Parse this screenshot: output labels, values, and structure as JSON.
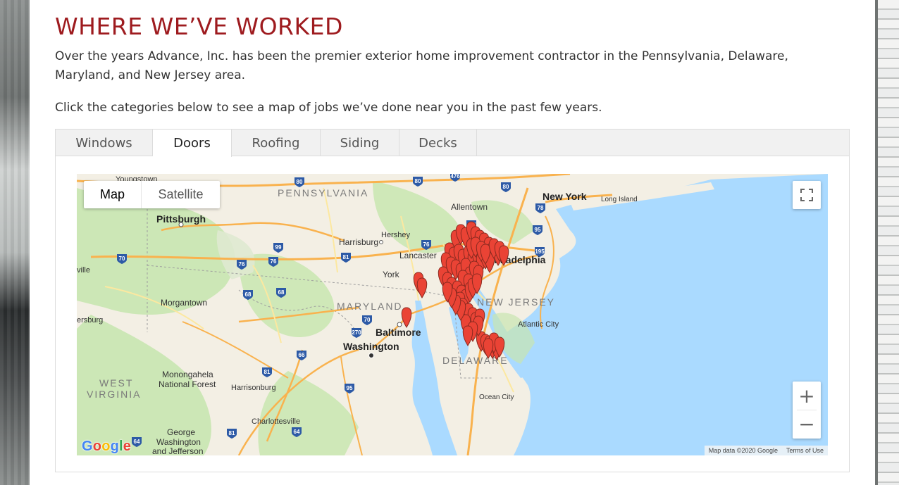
{
  "page": {
    "heading": "WHERE WE’VE WORKED",
    "intro": "Over the years Advance, Inc. has been the premier exterior home improvement contractor in the Pennsylvania, Delaware, Maryland, and New Jersey area.",
    "cta": "Click the categories below to see a map of jobs we’ve done near you in the past few years."
  },
  "tabs": [
    {
      "label": "Windows",
      "active": false
    },
    {
      "label": "Doors",
      "active": true
    },
    {
      "label": "Roofing",
      "active": false
    },
    {
      "label": "Siding",
      "active": false
    },
    {
      "label": "Decks",
      "active": false
    }
  ],
  "map": {
    "type_control": {
      "map_label": "Map",
      "satellite_label": "Satellite",
      "selected": "Map"
    },
    "zoom_in": "+",
    "zoom_out": "−",
    "attribution": "Map data ©2020 Google",
    "terms": "Terms of Use",
    "logo": {
      "G": "G",
      "o1": "o",
      "o2": "o",
      "g": "g",
      "l": "l",
      "e": "e"
    },
    "state_labels": [
      "PENNSYLVANIA",
      "MARYLAND",
      "NEW JERSEY",
      "DELAWARE",
      "WEST",
      "VIRGINIA"
    ],
    "city_labels": [
      "Youngstown",
      "Pittsburgh",
      "Allentown",
      "New York",
      "Long Island",
      "Harrisburg",
      "Hershey",
      "Lancaster",
      "York",
      "Philadelphia",
      "Morgantown",
      "Atlantic City",
      "Baltimore",
      "Washington",
      "Ocean City",
      "Monongahela",
      "National Forest",
      "Harrisonburg",
      "Charlottesville",
      "George",
      "Washington",
      "and Jefferson",
      "ville",
      "ersburg"
    ],
    "highway_labels": [
      "80",
      "80",
      "476",
      "80",
      "78",
      "476",
      "95",
      "76",
      "99",
      "76",
      "81",
      "70",
      "76",
      "195",
      "68",
      "68",
      "70",
      "270",
      "66",
      "81",
      "95",
      "64",
      "81",
      "64"
    ],
    "colors": {
      "water": "#aadaff",
      "land": "#f3efe4",
      "park": "#c8e6b0",
      "marker": "#ea4335",
      "heading": "#9e1b1f"
    }
  }
}
